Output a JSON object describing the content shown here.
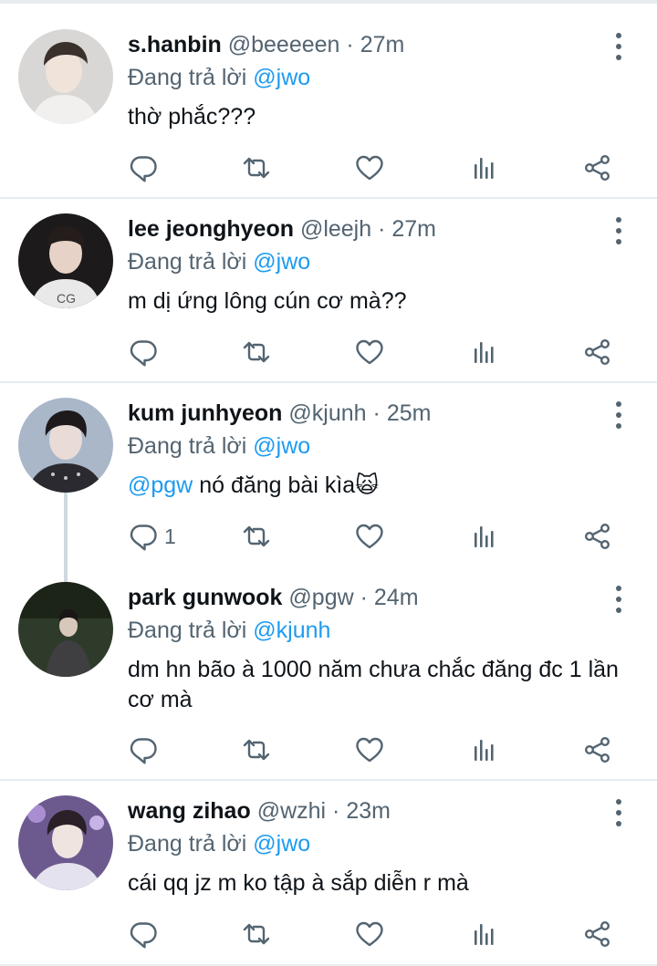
{
  "reply_prefix": "Đang trả lời",
  "tweets": [
    {
      "name": "s.hanbin",
      "handle": "@beeeeen",
      "sep": "·",
      "time": "27m",
      "reply_to": "@jwo",
      "text_parts": [
        "thờ phắc???"
      ],
      "reply_count": ""
    },
    {
      "name": "lee jeonghyeon",
      "handle": "@leejh",
      "sep": "·",
      "time": "27m",
      "reply_to": "@jwo",
      "text_parts": [
        "m dị ứng lông cún cơ mà??"
      ],
      "reply_count": ""
    },
    {
      "name": "kum junhyeon",
      "handle": "@kjunh",
      "sep": "·",
      "time": "25m",
      "reply_to": "@jwo",
      "text_mention": "@pgw",
      "text_parts": [
        " nó đăng bài kìa🙀"
      ],
      "reply_count": "1"
    },
    {
      "name": "park gunwook",
      "handle": "@pgw",
      "sep": "·",
      "time": "24m",
      "reply_to": "@kjunh",
      "text_parts": [
        "dm hn bão à 1000 năm chưa chắc đăng đc 1 lần cơ mà"
      ],
      "reply_count": ""
    },
    {
      "name": "wang zihao",
      "handle": "@wzhi",
      "sep": "·",
      "time": "23m",
      "reply_to": "@jwo",
      "text_parts": [
        "cái qq jz m ko tập à sắp diễn r mà"
      ],
      "reply_count": ""
    }
  ],
  "icons": {
    "reply": "reply-icon",
    "retweet": "retweet-icon",
    "like": "heart-icon",
    "views": "analytics-icon",
    "share": "share-icon",
    "more": "more-vertical-icon"
  },
  "colors": {
    "icon": "#536471",
    "mention": "#1d9bf0",
    "divider": "#e6ecf0"
  }
}
